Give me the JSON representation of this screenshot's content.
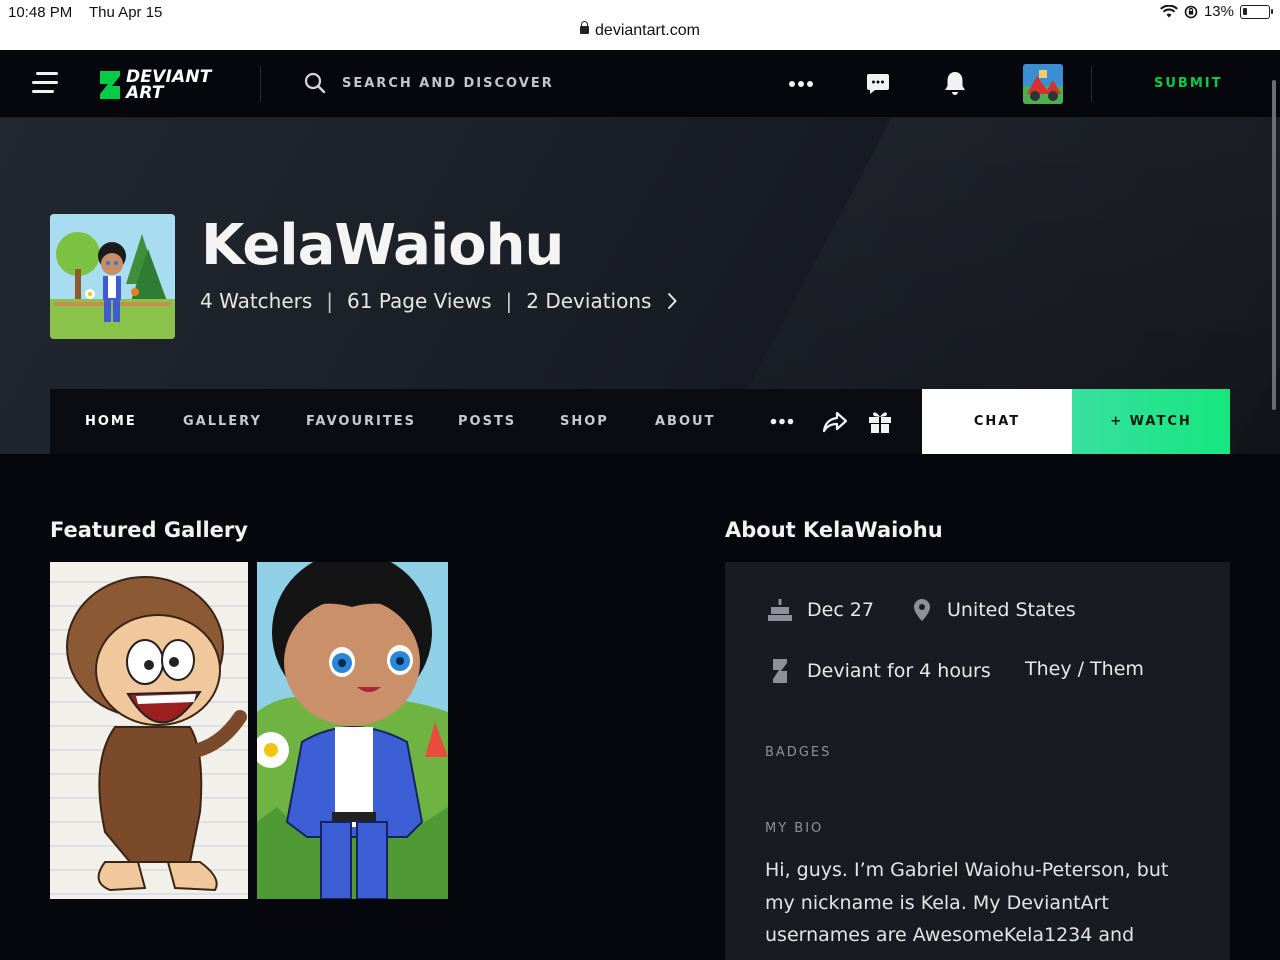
{
  "status_bar": {
    "time": "10:48 PM",
    "date": "Thu Apr 15",
    "battery": "13%"
  },
  "browser": {
    "url": "deviantart.com"
  },
  "header": {
    "logo_line1": "DEVIANT",
    "logo_line2": "ART",
    "search_placeholder": "SEARCH AND DISCOVER",
    "submit_label": "SUBMIT",
    "icons": [
      "menu-icon",
      "more-icon",
      "chat-bubble-icon",
      "bell-icon"
    ]
  },
  "profile": {
    "username": "KelaWaiohu",
    "watchers": "4 Watchers",
    "page_views": "61 Page Views",
    "deviations": "2 Deviations",
    "separator": "|"
  },
  "tabs": {
    "items": [
      "HOME",
      "GALLERY",
      "FAVOURITES",
      "POSTS",
      "SHOP",
      "ABOUT"
    ],
    "active": "HOME",
    "chat_label": "CHAT",
    "watch_label": "+ WATCH"
  },
  "featured": {
    "title": "Featured Gallery"
  },
  "about": {
    "title": "About KelaWaiohu",
    "birthday": "Dec 27",
    "location": "United States",
    "deviant_for": "Deviant for 4 hours",
    "pronouns": "They / Them",
    "badges_label": "BADGES",
    "bio_label": "MY BIO",
    "bio_text": "Hi, guys. I’m Gabriel Waiohu-Peterson, but my nickname is Kela. My DeviantArt usernames are AwesomeKela1234 and"
  },
  "colors": {
    "accent_green": "#05cc47",
    "watch_gradient_start": "#37e0a0",
    "watch_gradient_end": "#16e67e",
    "background": "#06070d"
  }
}
